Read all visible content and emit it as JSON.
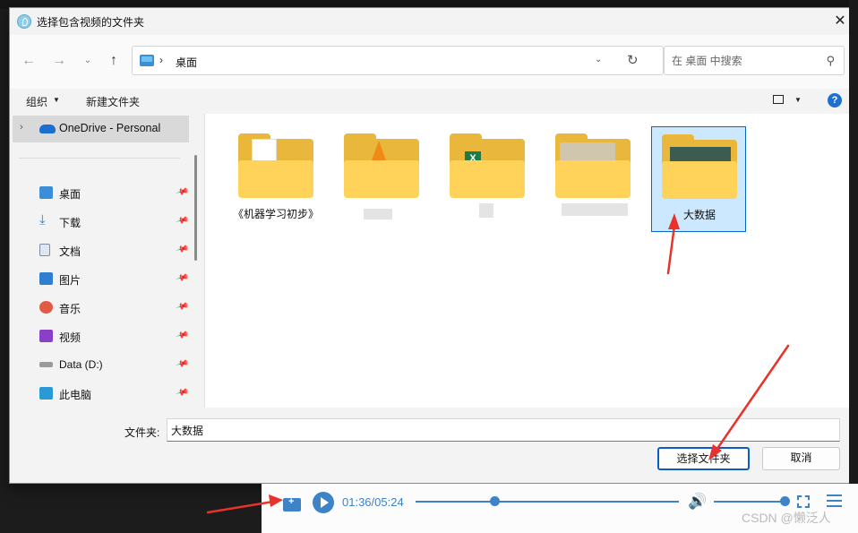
{
  "dialog": {
    "title": "选择包含视频的文件夹",
    "close_label": "✕"
  },
  "nav": {
    "back_icon": "arrow-left-icon",
    "forward_icon": "arrow-right-icon",
    "up_icon": "arrow-up-icon",
    "address_separator": "›",
    "address_path": "桌面",
    "search_placeholder": "在 桌面 中搜索"
  },
  "toolbar": {
    "organize_label": "组织",
    "new_folder_label": "新建文件夹",
    "help_label": "?"
  },
  "sidebar": {
    "onedrive_label": "OneDrive - Personal",
    "items": [
      {
        "label": "桌面",
        "icon": "desktop-icon",
        "color": "#3a8fd8"
      },
      {
        "label": "下载",
        "icon": "download-icon",
        "color": "#2f84d3"
      },
      {
        "label": "文档",
        "icon": "document-icon",
        "color": "#7a8ea6"
      },
      {
        "label": "图片",
        "icon": "pictures-icon",
        "color": "#2f7fd0"
      },
      {
        "label": "音乐",
        "icon": "music-icon",
        "color": "#e05a44"
      },
      {
        "label": "视频",
        "icon": "video-icon",
        "color": "#8a3fc9"
      },
      {
        "label": "Data (D:)",
        "icon": "drive-icon",
        "color": "#7a7a7a"
      },
      {
        "label": "此电脑",
        "icon": "computer-icon",
        "color": "#2a9ad6"
      }
    ]
  },
  "folders": [
    {
      "name": "《机器学习初步》",
      "icon": "folder-document-icon"
    },
    {
      "name": "",
      "icon": "folder-vlc-icon"
    },
    {
      "name": "",
      "icon": "folder-excel-icon"
    },
    {
      "name": "",
      "icon": "folder-blurred-icon"
    },
    {
      "name": "大数据",
      "icon": "folder-photo-icon",
      "selected": true
    }
  ],
  "footer": {
    "folder_label": "文件夹:",
    "folder_value": "大数据",
    "ok_label": "选择文件夹",
    "cancel_label": "取消"
  },
  "player": {
    "time": "01:36/05:24",
    "progress": 0.3,
    "volume": 1.0,
    "accent_color": "#3e82c8"
  },
  "watermark": "CSDN @懒泛人",
  "annotation_color": "#e8322a"
}
